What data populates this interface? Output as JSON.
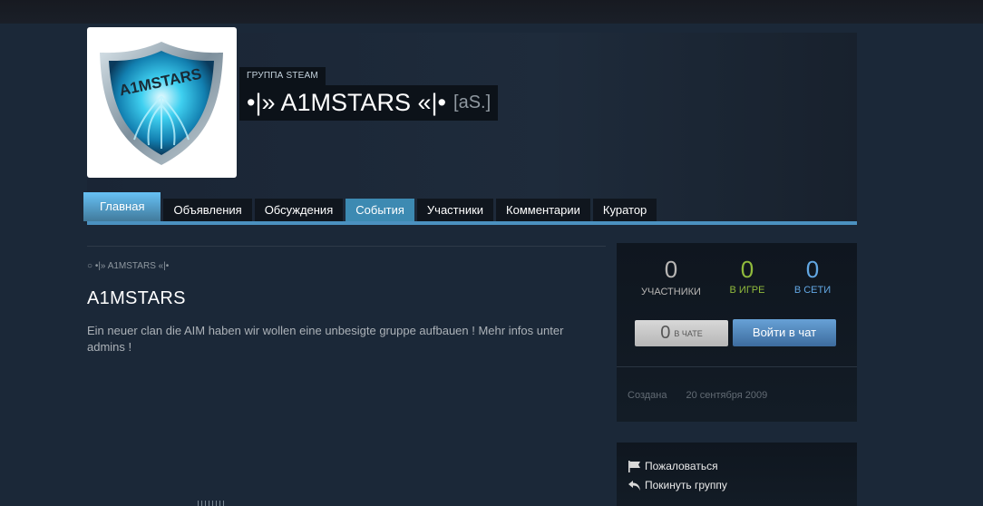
{
  "group": {
    "tag": "ГРУППА STEAM",
    "name": "•|» A1MSTARS «|•",
    "abbr": "[aS.]",
    "avatar_text": "A1MSTARS"
  },
  "tabs": [
    {
      "label": "Главная"
    },
    {
      "label": "Объявления"
    },
    {
      "label": "Обсуждения"
    },
    {
      "label": "События"
    },
    {
      "label": "Участники"
    },
    {
      "label": "Комментарии"
    },
    {
      "label": "Куратор"
    }
  ],
  "content": {
    "breadcrumb": "○ •|» A1MSTARS «|•",
    "title": "A1MSTARS",
    "body": "Ein neuer clan die AIM haben wir wollen eine unbesigte gruppe aufbauen ! Mehr infos unter admins !"
  },
  "stats": {
    "members": {
      "value": "0",
      "label": "УЧАСТНИКИ"
    },
    "ingame": {
      "value": "0",
      "label": "В ИГРЕ"
    },
    "online": {
      "value": "0",
      "label": "В СЕТИ"
    },
    "chat": {
      "value": "0",
      "label": "В ЧАТЕ"
    },
    "join_label": "Войти в чат",
    "founded_label": "Создана",
    "founded_date": "20 сентября 2009"
  },
  "actions": {
    "report": "Пожаловаться",
    "leave": "Покинуть группу"
  },
  "icons": {
    "report": "flag-icon",
    "leave": "leave-icon"
  },
  "colors": {
    "background": "#1b2838",
    "tab_active": "#67c1f5",
    "ingame": "#90ba3c",
    "online": "#62a7e3"
  }
}
